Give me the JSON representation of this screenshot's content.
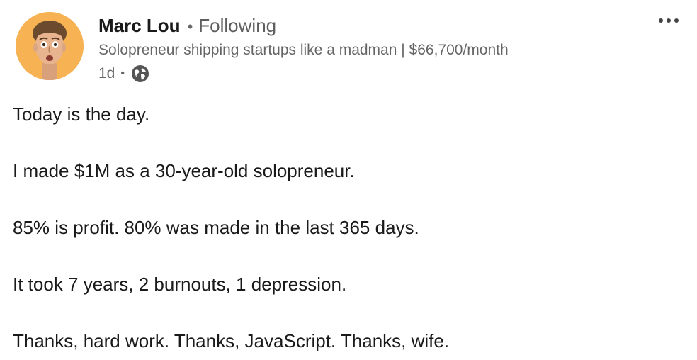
{
  "author": {
    "name": "Marc Lou",
    "separator": "•",
    "follow_status": "Following",
    "headline": "Solopreneur shipping startups like a madman | $66,700/month",
    "avatar_bg": "#f6b253"
  },
  "meta": {
    "time": "1d",
    "separator": "•",
    "visibility_icon": "globe-icon"
  },
  "actions": {
    "more_icon": "ellipsis-icon"
  },
  "body": {
    "lines": [
      "Today is the day.",
      "I made $1M as a 30-year-old solopreneur.",
      "85% is profit. 80% was made in the last 365 days.",
      "It took 7 years, 2 burnouts, 1 depression.",
      "Thanks, hard work. Thanks, JavaScript. Thanks, wife."
    ]
  }
}
